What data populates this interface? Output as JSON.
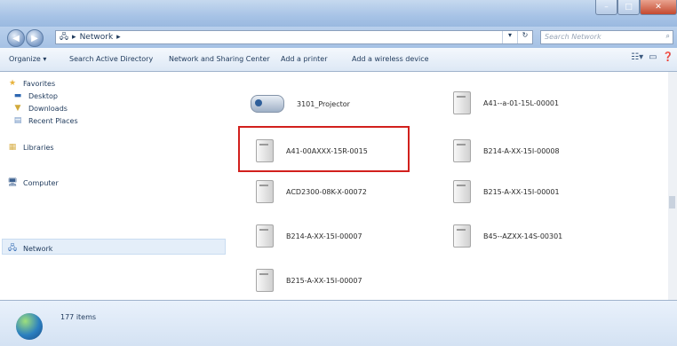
{
  "window": {
    "controls": [
      "–",
      "□",
      "✕"
    ]
  },
  "address": {
    "crumb": "Network",
    "search_placeholder": "Search Network"
  },
  "toolbar": {
    "organize": "Organize ▾",
    "search_ad": "Search Active Directory",
    "nsc": "Network and Sharing Center",
    "add_printer": "Add a printer",
    "add_wireless": "Add a wireless device"
  },
  "nav": {
    "favorites": "Favorites",
    "desktop": "Desktop",
    "downloads": "Downloads",
    "recent": "Recent Places",
    "libraries": "Libraries",
    "computer": "Computer",
    "network": "Network"
  },
  "items": [
    {
      "name": "3101_Projector"
    },
    {
      "name": "A41--a-01-15L-00001"
    },
    {
      "name": "A41-00AXXX-15R-0015"
    },
    {
      "name": "B214-A-XX-15I-00008"
    },
    {
      "name": "ACD2300-08K-X-00072"
    },
    {
      "name": "B215-A-XX-15I-00001"
    },
    {
      "name": "B214-A-XX-15I-00007"
    },
    {
      "name": "B45--AZXX-14S-00301"
    },
    {
      "name": "B215-A-XX-15I-00007"
    }
  ],
  "status": {
    "count": "177 items"
  },
  "colors": {
    "highlight": "#d2201d",
    "accent": "#1e395b"
  }
}
